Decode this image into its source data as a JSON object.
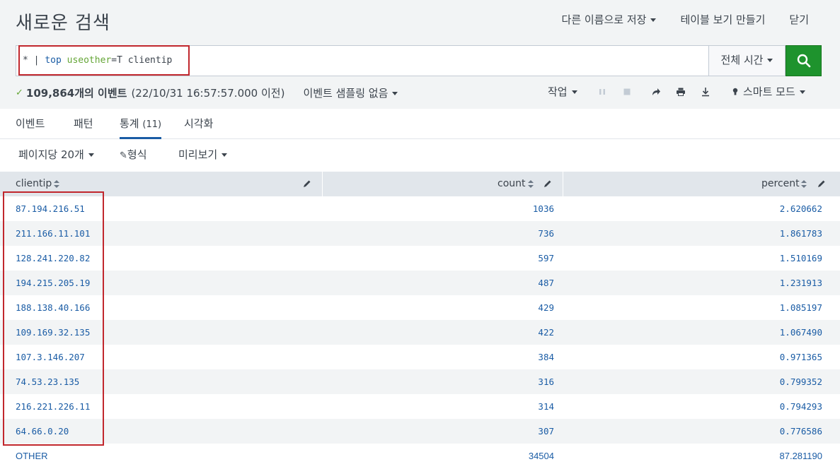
{
  "header": {
    "title": "새로운 검색",
    "actions": [
      "다른 이름으로 저장",
      "테이블 보기 만들기",
      "닫기"
    ]
  },
  "search": {
    "query_parts": [
      "* | ",
      "top",
      " ",
      "useother",
      "=T clientip"
    ],
    "time_range": "전체 시간"
  },
  "status": {
    "event_count": "109,864개의 이벤트",
    "event_time": "(22/10/31 16:57:57.000 이전)",
    "sampling": "이벤트 샘플링 없음",
    "job": "작업",
    "mode": "스마트 모드"
  },
  "tabs": [
    {
      "label": "이벤트",
      "count": ""
    },
    {
      "label": "패턴",
      "count": ""
    },
    {
      "label": "통계",
      "count": "(11)"
    },
    {
      "label": "시각화",
      "count": ""
    }
  ],
  "options": {
    "per_page": "페이지당 20개",
    "format": "형식",
    "preview": "미리보기"
  },
  "table": {
    "columns": [
      "clientip",
      "count",
      "percent"
    ],
    "rows": [
      [
        "87.194.216.51",
        "1036",
        "2.620662"
      ],
      [
        "211.166.11.101",
        "736",
        "1.861783"
      ],
      [
        "128.241.220.82",
        "597",
        "1.510169"
      ],
      [
        "194.215.205.19",
        "487",
        "1.231913"
      ],
      [
        "188.138.40.166",
        "429",
        "1.085197"
      ],
      [
        "109.169.32.135",
        "422",
        "1.067490"
      ],
      [
        "107.3.146.207",
        "384",
        "0.971365"
      ],
      [
        "74.53.23.135",
        "316",
        "0.799352"
      ],
      [
        "216.221.226.11",
        "314",
        "0.794293"
      ],
      [
        "64.66.0.20",
        "307",
        "0.776586"
      ],
      [
        "OTHER",
        "34504",
        "87.281190"
      ]
    ]
  },
  "colors": {
    "accent": "#1a5ca5",
    "search_button": "#1e932d",
    "highlight": "#c1272d",
    "success_check": "#65a637"
  }
}
